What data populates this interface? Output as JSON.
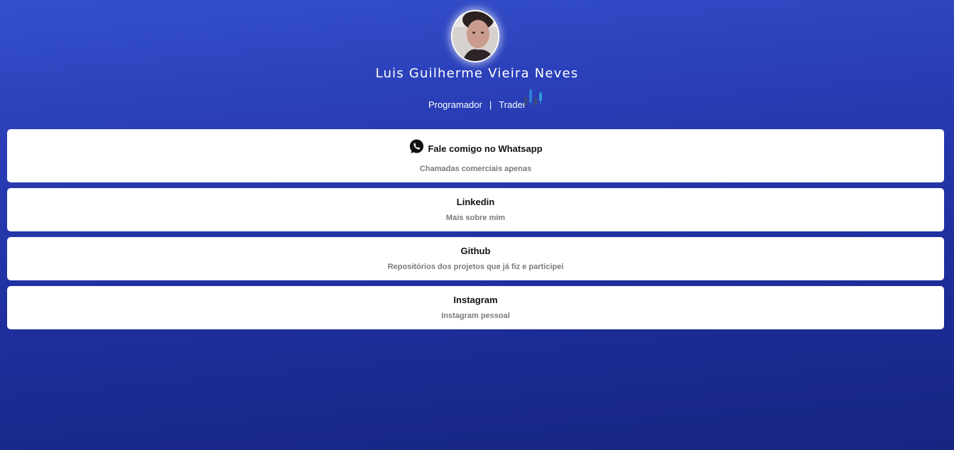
{
  "profile": {
    "name": "Luis Guilherme Vieira Neves",
    "role_1": "Programador",
    "separator": "|",
    "role_2": "Trader",
    "avatar_icon": "avatar-photo",
    "role_icon": "candlestick-chart-icon"
  },
  "links": [
    {
      "title": "Fale comigo no Whatsapp",
      "subtitle": "Chamadas comerciais apenas",
      "icon": "whatsapp-icon"
    },
    {
      "title": "Linkedin",
      "subtitle": "Mais sobre mim"
    },
    {
      "title": "Github",
      "subtitle": "Repositórios dos projetos que já fiz e participei"
    },
    {
      "title": "Instagram",
      "subtitle": "Instagram pessoal"
    }
  ],
  "colors": {
    "background_top": "#3550cc",
    "background_bottom": "#162580",
    "card": "#ffffff",
    "title_text": "#111111",
    "subtitle_text": "#7a7a7a"
  }
}
